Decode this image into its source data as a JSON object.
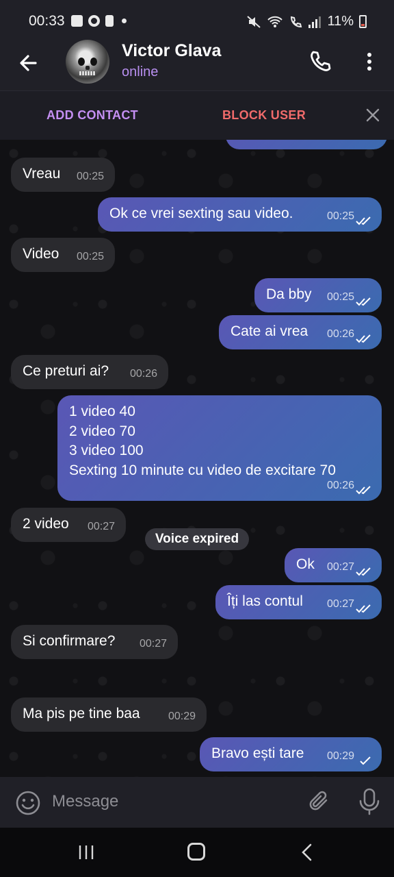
{
  "status_bar": {
    "time": "00:33",
    "battery": "11%"
  },
  "header": {
    "name": "Victor Glava",
    "status": "online"
  },
  "action_bar": {
    "add_contact": "ADD CONTACT",
    "block_user": "BLOCK USER"
  },
  "messages": [
    {
      "dir": "in",
      "text": "Vreau",
      "time": "00:25"
    },
    {
      "dir": "out",
      "text": "Ok ce vrei sexting sau video.",
      "time": "00:25",
      "ticks": "double"
    },
    {
      "dir": "in",
      "text": "Video",
      "time": "00:25"
    },
    {
      "dir": "out",
      "text": "Da bby",
      "time": "00:25",
      "ticks": "double"
    },
    {
      "dir": "out",
      "text": "Cate ai vrea",
      "time": "00:26",
      "ticks": "double"
    },
    {
      "dir": "in",
      "text": "Ce preturi ai?",
      "time": "00:26"
    },
    {
      "dir": "out",
      "lines": [
        "1 video 40",
        "2 video 70",
        "3 video 100",
        "Sexting 10 minute cu video de excitare 70"
      ],
      "time": "00:26",
      "ticks": "double"
    },
    {
      "dir": "in",
      "text": "2 video",
      "time": "00:27"
    },
    {
      "dir": "out",
      "text": "Ok",
      "time": "00:27",
      "ticks": "double"
    },
    {
      "dir": "out",
      "text": "Îți las contul",
      "time": "00:27",
      "ticks": "double"
    },
    {
      "dir": "in",
      "text": "Si confirmare?",
      "time": "00:27"
    },
    {
      "dir": "service",
      "text": "Voice expired"
    },
    {
      "dir": "in",
      "text": "Ma pis pe tine baa",
      "time": "00:29"
    },
    {
      "dir": "out",
      "text": "Bravo ești tare",
      "time": "00:29",
      "ticks": "single"
    }
  ],
  "composer": {
    "placeholder": "Message"
  },
  "colors": {
    "accent": "#b88ff0",
    "danger": "#f06b6b",
    "outgoing": "#4a62b3",
    "incoming": "#2a2a2e"
  }
}
